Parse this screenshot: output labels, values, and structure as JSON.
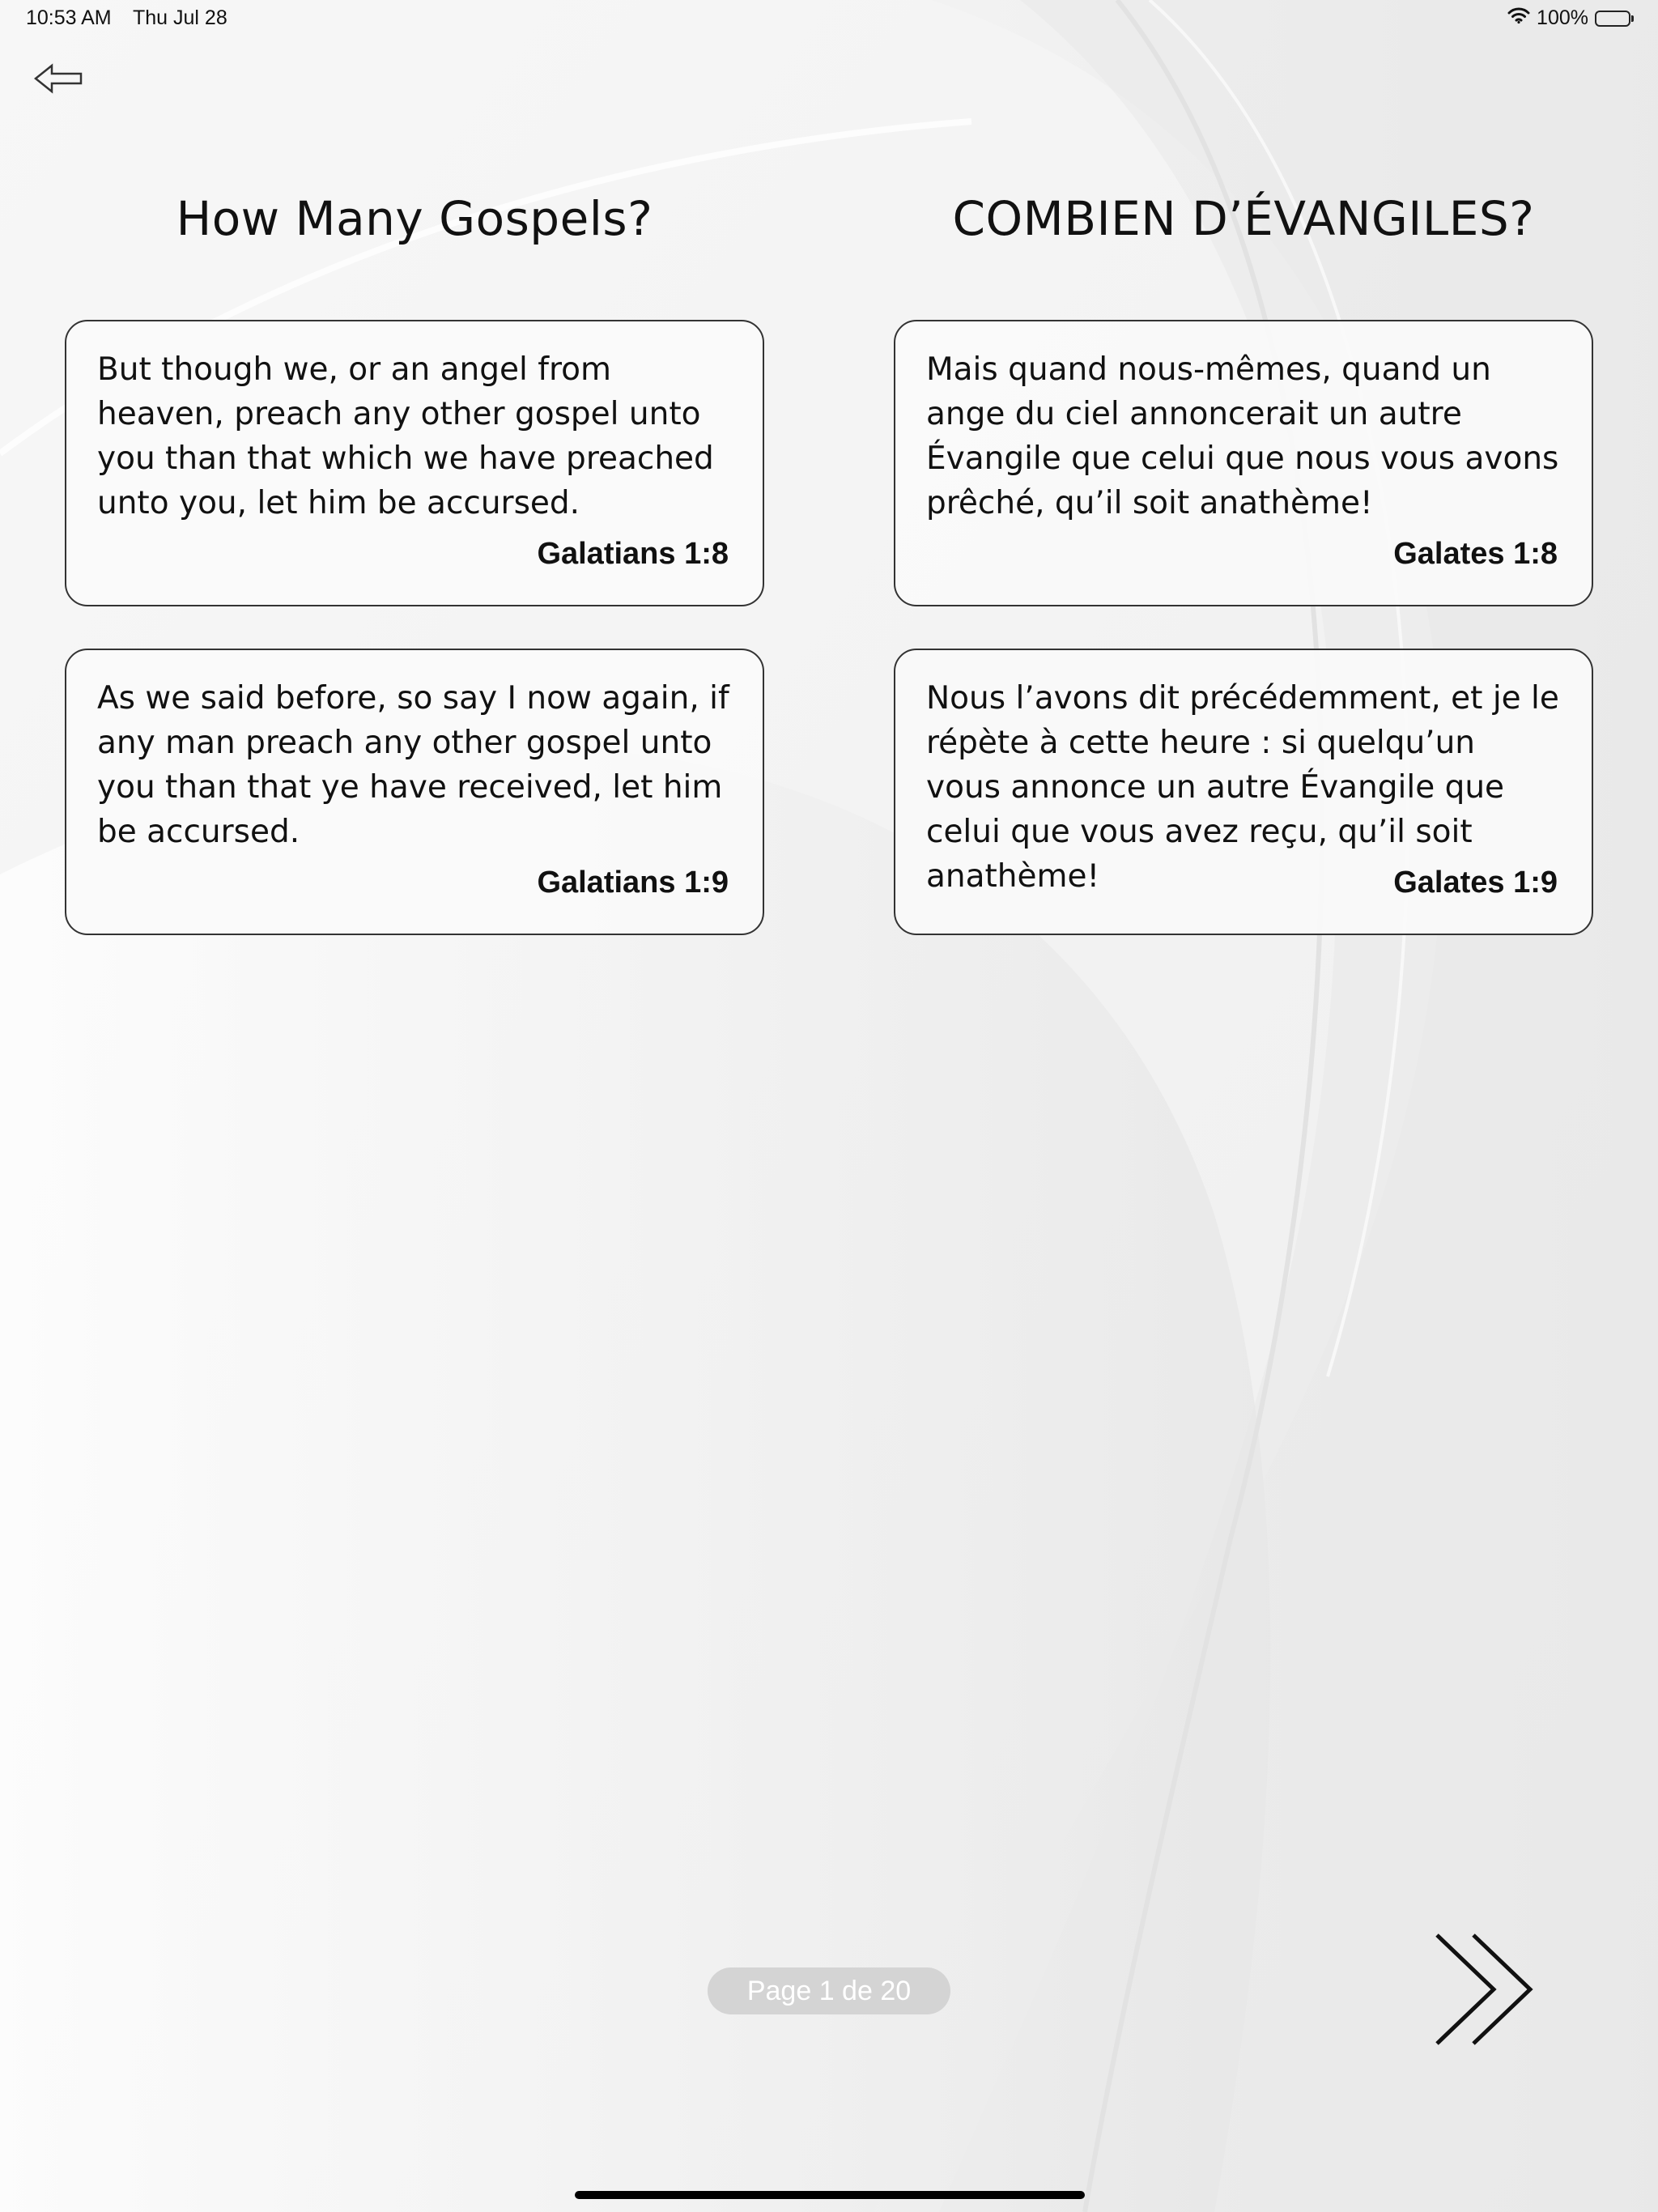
{
  "status_bar": {
    "time": "10:53 AM",
    "date": "Thu Jul 28",
    "battery": "100%"
  },
  "icons": {
    "back": "back-arrow-icon",
    "next": "double-chevron-right-icon",
    "wifi": "wifi-icon",
    "battery": "battery-icon"
  },
  "english": {
    "title": "How Many Gospels?",
    "cards": [
      {
        "text": "But though we, or an angel from heaven, preach any other gospel unto you than that which we have preached unto you, let him be accursed.",
        "reference": "Galatians 1:8"
      },
      {
        "text": "As we said before, so say I now again, if any man preach any other gospel unto you than that ye have received, let him be accursed.",
        "reference": "Galatians 1:9"
      }
    ]
  },
  "french": {
    "title": "COMBIEN D’ÉVANGILES?",
    "cards": [
      {
        "text": "Mais quand nous-mêmes, quand un ange du ciel annoncerait un autre Évangile que celui que nous vous avons prêché, qu’il soit anathème!",
        "reference": "Galates 1:8"
      },
      {
        "text": "Nous l’avons dit précédemment, et je le répète à cette heure : si quelqu’un vous annonce un autre Évangile que celui que vous avez reçu, qu’il soit anathème!",
        "reference": "Galates 1:9"
      }
    ]
  },
  "pagination": {
    "label": "Page 1 de 20"
  },
  "colors": {
    "background": "#f4f4f4",
    "card_border": "#333333",
    "page_pill": "#d4d4d4",
    "text": "#111111"
  }
}
